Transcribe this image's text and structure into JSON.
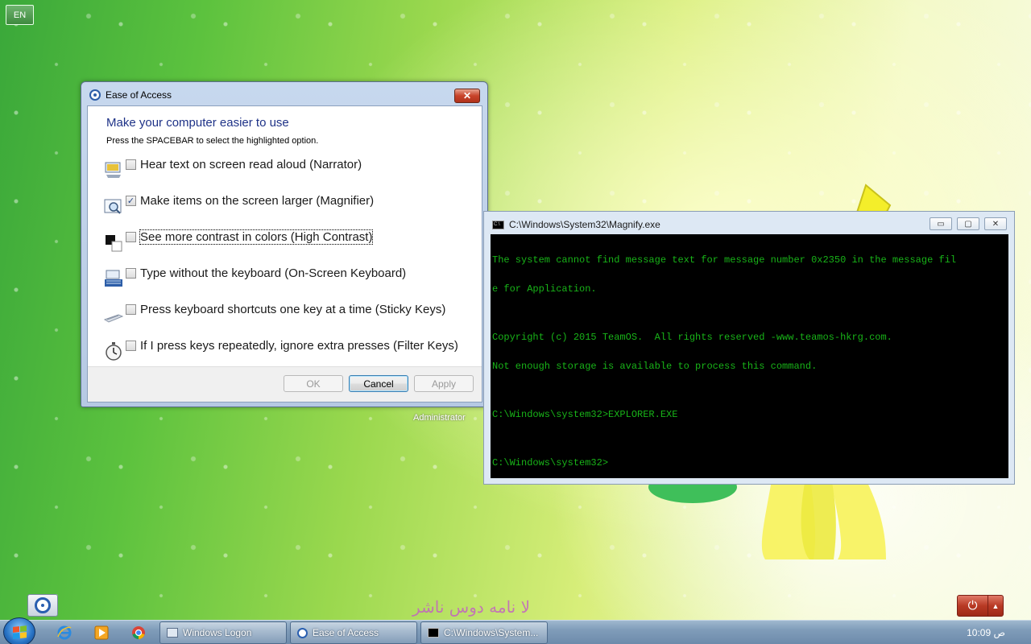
{
  "language_button": "EN",
  "ease_of_access_dialog": {
    "title": "Ease of Access",
    "close_label": "✕",
    "heading": "Make your computer easier to use",
    "instruction": "Press the SPACEBAR to select the highlighted option.",
    "options": [
      {
        "label": "Hear text on screen read aloud (Narrator)",
        "checked": false,
        "icon": "narrator-icon"
      },
      {
        "label": "Make items on the screen larger (Magnifier)",
        "checked": true,
        "icon": "magnifier-icon"
      },
      {
        "label": "See more contrast in colors (High Contrast)",
        "checked": false,
        "icon": "high-contrast-icon"
      },
      {
        "label": "Type without the keyboard (On-Screen Keyboard)",
        "checked": false,
        "icon": "keyboard-icon"
      },
      {
        "label": "Press keyboard shortcuts one key at a time (Sticky Keys)",
        "checked": false,
        "icon": "sticky-keys-icon"
      },
      {
        "label": "If I press keys repeatedly, ignore extra presses (Filter Keys)",
        "checked": false,
        "icon": "stopwatch-icon"
      }
    ],
    "buttons": {
      "ok": "OK",
      "cancel": "Cancel",
      "apply": "Apply"
    }
  },
  "user_label": "Administrator",
  "console": {
    "title": "C:\\Windows\\System32\\Magnify.exe",
    "icon_text": "C:\\",
    "minimize": "▭",
    "maximize": "▢",
    "close": "✕",
    "lines": [
      "The system cannot find message text for message number 0x2350 in the message fil",
      "e for Application.",
      "",
      "Copyright (c) 2015 TeamOS.  All rights reserved -www.teamos-hkrg.com.",
      "Not enough storage is available to process this command.",
      "",
      "C:\\Windows\\system32>EXPLORER.EXE",
      "",
      "C:\\Windows\\system32>"
    ]
  },
  "branding_text": "ﻻ ﻧﺎﻣﻪ ﺩﻭﺱ  ﻧﺎﺷﺮ",
  "shutdown": {
    "power_symbol": "⏻",
    "arrow": "▲"
  },
  "taskbar": {
    "tasks": [
      {
        "label": "Windows Logon"
      },
      {
        "label": "Ease of Access"
      },
      {
        "label": "C:\\Windows\\System..."
      }
    ],
    "clock": "10:09 ص"
  }
}
